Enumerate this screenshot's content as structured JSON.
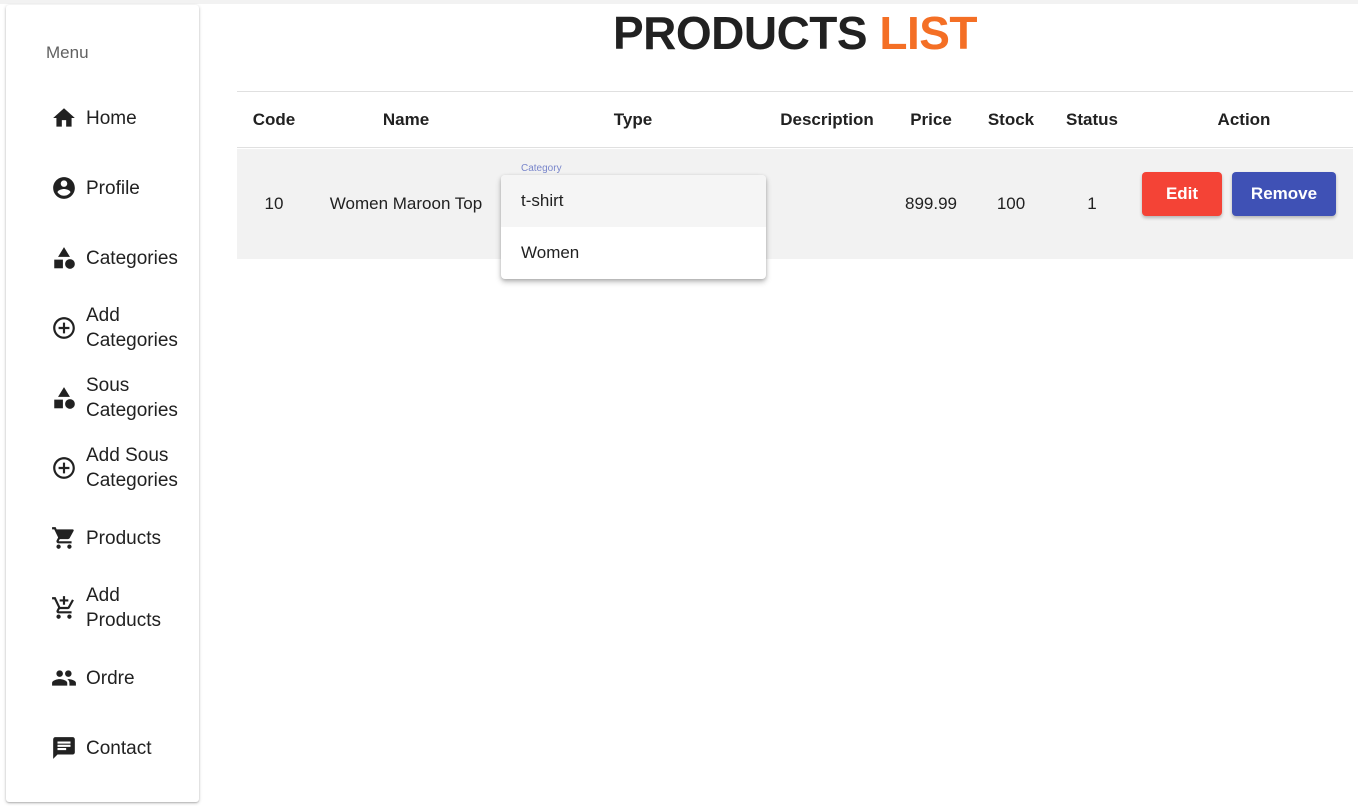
{
  "sidebar": {
    "menu_title": "Menu",
    "items": [
      {
        "label": "Home",
        "icon": "home-icon"
      },
      {
        "label": "Profile",
        "icon": "account-circle-icon"
      },
      {
        "label": "Categories",
        "icon": "category-icon"
      },
      {
        "label": "Add\nCategories",
        "icon": "add-circle-icon"
      },
      {
        "label": "Sous\nCategories",
        "icon": "category-icon"
      },
      {
        "label": "Add Sous\nCategories",
        "icon": "add-circle-icon"
      },
      {
        "label": "Products",
        "icon": "shopping-cart-icon"
      },
      {
        "label": "Add\nProducts",
        "icon": "add-shopping-cart-icon"
      },
      {
        "label": "Ordre",
        "icon": "people-icon"
      },
      {
        "label": "Contact",
        "icon": "chat-icon"
      }
    ]
  },
  "page": {
    "title_part1": "PRODUCTS",
    "title_part2": "LIST"
  },
  "table": {
    "headers": [
      "Code",
      "Name",
      "Type",
      "Description",
      "Price",
      "Stock",
      "Status",
      "Action"
    ],
    "rows": [
      {
        "code": "10",
        "name": "Women Maroon Top",
        "type_label": "Category",
        "description": "",
        "price": "899.99",
        "stock": "100",
        "status": "1",
        "edit_label": "Edit",
        "remove_label": "Remove"
      }
    ]
  },
  "dropdown": {
    "options": [
      "t-shirt",
      "Women"
    ],
    "selected_index": 0
  },
  "colors": {
    "title_accent": "#f46f25",
    "edit_button": "#f44336",
    "remove_button": "#3f51b5",
    "row_background": "#f2f2f2"
  }
}
